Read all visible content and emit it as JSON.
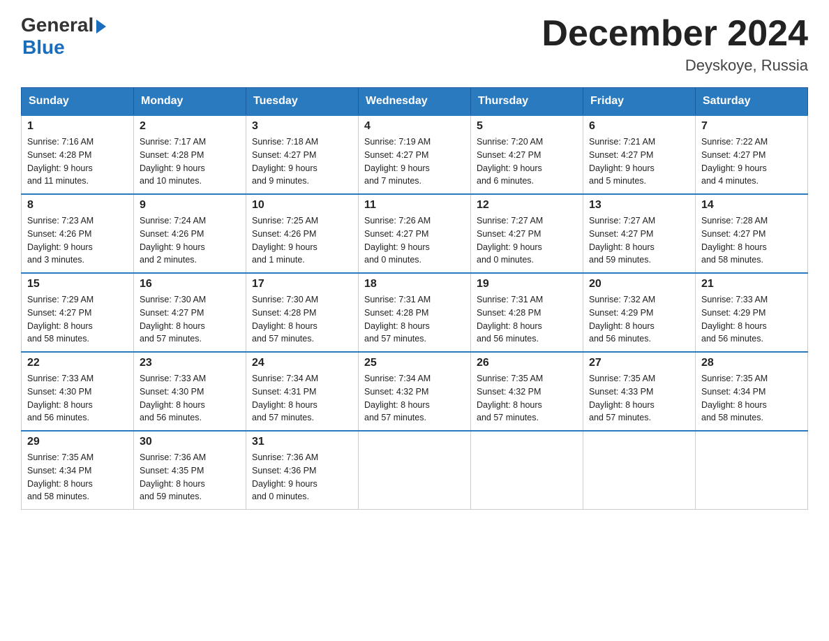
{
  "header": {
    "logo_general": "General",
    "logo_blue": "Blue",
    "title": "December 2024",
    "subtitle": "Deyskoye, Russia"
  },
  "weekdays": [
    "Sunday",
    "Monday",
    "Tuesday",
    "Wednesday",
    "Thursday",
    "Friday",
    "Saturday"
  ],
  "weeks": [
    [
      {
        "day": "1",
        "sunrise": "7:16 AM",
        "sunset": "4:28 PM",
        "daylight": "9 hours and 11 minutes."
      },
      {
        "day": "2",
        "sunrise": "7:17 AM",
        "sunset": "4:28 PM",
        "daylight": "9 hours and 10 minutes."
      },
      {
        "day": "3",
        "sunrise": "7:18 AM",
        "sunset": "4:27 PM",
        "daylight": "9 hours and 9 minutes."
      },
      {
        "day": "4",
        "sunrise": "7:19 AM",
        "sunset": "4:27 PM",
        "daylight": "9 hours and 7 minutes."
      },
      {
        "day": "5",
        "sunrise": "7:20 AM",
        "sunset": "4:27 PM",
        "daylight": "9 hours and 6 minutes."
      },
      {
        "day": "6",
        "sunrise": "7:21 AM",
        "sunset": "4:27 PM",
        "daylight": "9 hours and 5 minutes."
      },
      {
        "day": "7",
        "sunrise": "7:22 AM",
        "sunset": "4:27 PM",
        "daylight": "9 hours and 4 minutes."
      }
    ],
    [
      {
        "day": "8",
        "sunrise": "7:23 AM",
        "sunset": "4:26 PM",
        "daylight": "9 hours and 3 minutes."
      },
      {
        "day": "9",
        "sunrise": "7:24 AM",
        "sunset": "4:26 PM",
        "daylight": "9 hours and 2 minutes."
      },
      {
        "day": "10",
        "sunrise": "7:25 AM",
        "sunset": "4:26 PM",
        "daylight": "9 hours and 1 minute."
      },
      {
        "day": "11",
        "sunrise": "7:26 AM",
        "sunset": "4:27 PM",
        "daylight": "9 hours and 0 minutes."
      },
      {
        "day": "12",
        "sunrise": "7:27 AM",
        "sunset": "4:27 PM",
        "daylight": "9 hours and 0 minutes."
      },
      {
        "day": "13",
        "sunrise": "7:27 AM",
        "sunset": "4:27 PM",
        "daylight": "8 hours and 59 minutes."
      },
      {
        "day": "14",
        "sunrise": "7:28 AM",
        "sunset": "4:27 PM",
        "daylight": "8 hours and 58 minutes."
      }
    ],
    [
      {
        "day": "15",
        "sunrise": "7:29 AM",
        "sunset": "4:27 PM",
        "daylight": "8 hours and 58 minutes."
      },
      {
        "day": "16",
        "sunrise": "7:30 AM",
        "sunset": "4:27 PM",
        "daylight": "8 hours and 57 minutes."
      },
      {
        "day": "17",
        "sunrise": "7:30 AM",
        "sunset": "4:28 PM",
        "daylight": "8 hours and 57 minutes."
      },
      {
        "day": "18",
        "sunrise": "7:31 AM",
        "sunset": "4:28 PM",
        "daylight": "8 hours and 57 minutes."
      },
      {
        "day": "19",
        "sunrise": "7:31 AM",
        "sunset": "4:28 PM",
        "daylight": "8 hours and 56 minutes."
      },
      {
        "day": "20",
        "sunrise": "7:32 AM",
        "sunset": "4:29 PM",
        "daylight": "8 hours and 56 minutes."
      },
      {
        "day": "21",
        "sunrise": "7:33 AM",
        "sunset": "4:29 PM",
        "daylight": "8 hours and 56 minutes."
      }
    ],
    [
      {
        "day": "22",
        "sunrise": "7:33 AM",
        "sunset": "4:30 PM",
        "daylight": "8 hours and 56 minutes."
      },
      {
        "day": "23",
        "sunrise": "7:33 AM",
        "sunset": "4:30 PM",
        "daylight": "8 hours and 56 minutes."
      },
      {
        "day": "24",
        "sunrise": "7:34 AM",
        "sunset": "4:31 PM",
        "daylight": "8 hours and 57 minutes."
      },
      {
        "day": "25",
        "sunrise": "7:34 AM",
        "sunset": "4:32 PM",
        "daylight": "8 hours and 57 minutes."
      },
      {
        "day": "26",
        "sunrise": "7:35 AM",
        "sunset": "4:32 PM",
        "daylight": "8 hours and 57 minutes."
      },
      {
        "day": "27",
        "sunrise": "7:35 AM",
        "sunset": "4:33 PM",
        "daylight": "8 hours and 57 minutes."
      },
      {
        "day": "28",
        "sunrise": "7:35 AM",
        "sunset": "4:34 PM",
        "daylight": "8 hours and 58 minutes."
      }
    ],
    [
      {
        "day": "29",
        "sunrise": "7:35 AM",
        "sunset": "4:34 PM",
        "daylight": "8 hours and 58 minutes."
      },
      {
        "day": "30",
        "sunrise": "7:36 AM",
        "sunset": "4:35 PM",
        "daylight": "8 hours and 59 minutes."
      },
      {
        "day": "31",
        "sunrise": "7:36 AM",
        "sunset": "4:36 PM",
        "daylight": "9 hours and 0 minutes."
      },
      null,
      null,
      null,
      null
    ]
  ],
  "labels": {
    "sunrise": "Sunrise:",
    "sunset": "Sunset:",
    "daylight": "Daylight:"
  }
}
